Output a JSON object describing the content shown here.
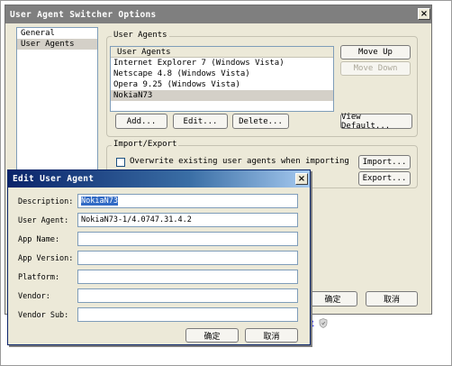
{
  "main_dialog": {
    "title": "User Agent Switcher Options",
    "close_label": "×",
    "categories": [
      {
        "label": "General",
        "selected": false
      },
      {
        "label": "User Agents",
        "selected": true
      }
    ],
    "user_agents_group": {
      "label": "User Agents",
      "list_header": "User Agents",
      "items": [
        {
          "label": "Internet Explorer 7 (Windows Vista)",
          "selected": false
        },
        {
          "label": "Netscape 4.8 (Windows Vista)",
          "selected": false
        },
        {
          "label": "Opera 9.25 (Windows Vista)",
          "selected": false
        },
        {
          "label": "NokiaN73",
          "selected": true
        }
      ],
      "move_up": "Move Up",
      "move_down": "Move Down",
      "add": "Add...",
      "edit": "Edit...",
      "delete": "Delete...",
      "view_default": "View Default..."
    },
    "import_export_group": {
      "label": "Import/Export",
      "overwrite_label": "Overwrite existing user agents when importing",
      "overwrite_checked": false,
      "import": "Import...",
      "export": "Export..."
    },
    "ok": "确定",
    "cancel": "取消"
  },
  "edit_dialog": {
    "title": "Edit User Agent",
    "fields": {
      "description": {
        "label": "Description:",
        "value": "NokiaN73",
        "selected_text": true
      },
      "user_agent": {
        "label": "User Agent:",
        "value": "NokiaN73-1/4.0747.31.4.2"
      },
      "app_name": {
        "label": "App Name:",
        "value": ""
      },
      "app_version": {
        "label": "App Version:",
        "value": ""
      },
      "platform": {
        "label": "Platform:",
        "value": ""
      },
      "vendor": {
        "label": "Vendor:",
        "value": ""
      },
      "vendor_sub": {
        "label": "Vendor Sub:",
        "value": ""
      }
    },
    "ok": "确定",
    "cancel": "取消"
  },
  "background": {
    "link_fragment": "e",
    "shield_icon": "shield-icon"
  }
}
